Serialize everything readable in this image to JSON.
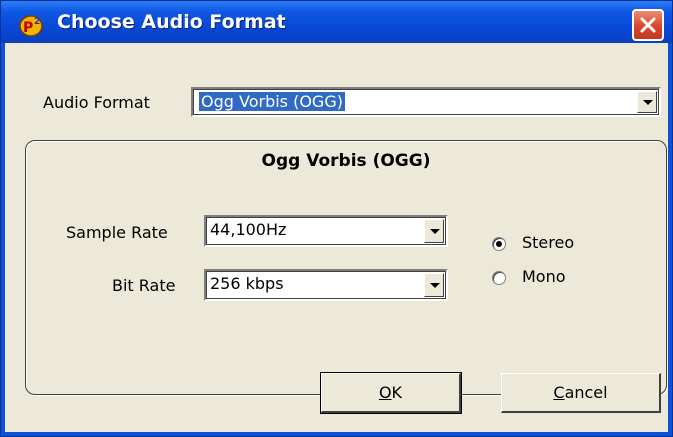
{
  "window": {
    "title": "Choose Audio Format",
    "icon": "p2-app-icon",
    "close_icon": "close-icon"
  },
  "audio_format": {
    "label": "Audio Format",
    "value": "Ogg Vorbis (OGG)"
  },
  "panel": {
    "title": "Ogg Vorbis (OGG)",
    "sample_rate": {
      "label": "Sample Rate",
      "value": "44,100Hz"
    },
    "bit_rate": {
      "label": "Bit Rate",
      "value": "256 kbps"
    },
    "channels": [
      {
        "label": "Stereo",
        "checked": true
      },
      {
        "label": "Mono",
        "checked": false
      }
    ]
  },
  "buttons": {
    "ok": {
      "mnemonic": "O",
      "rest": "K"
    },
    "cancel": {
      "mnemonic": "C",
      "rest": "ancel"
    }
  },
  "colors": {
    "titlebar": "#0746d2",
    "dialog_bg": "#ece9d8",
    "selection": "#316ac5",
    "close": "#d9462c"
  }
}
